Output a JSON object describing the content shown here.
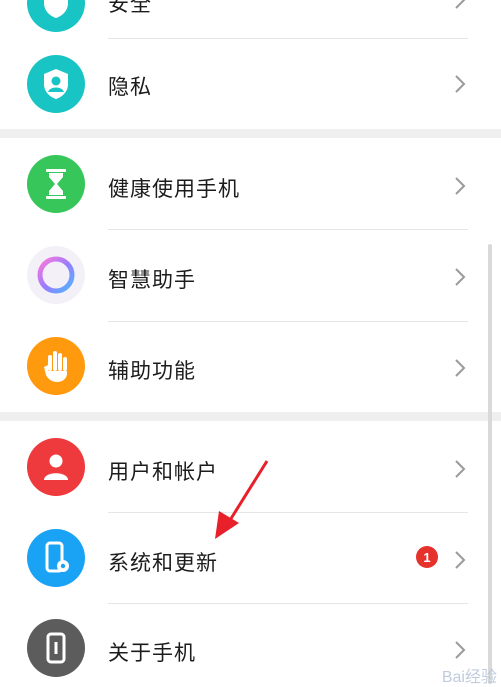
{
  "settings": {
    "items": [
      {
        "label": "安全",
        "icon": "shield-icon",
        "color": "#19c4c4"
      },
      {
        "label": "隐私",
        "icon": "privacy-shield-icon",
        "color": "#19c4c4"
      },
      {
        "label": "健康使用手机",
        "icon": "hourglass-icon",
        "color": "#36c65a"
      },
      {
        "label": "智慧助手",
        "icon": "assistant-ring-icon",
        "color": "#b07cf0"
      },
      {
        "label": "辅助功能",
        "icon": "hand-icon",
        "color": "#ff9a0f"
      },
      {
        "label": "用户和帐户",
        "icon": "user-icon",
        "color": "#ee3a3d"
      },
      {
        "label": "系统和更新",
        "icon": "phone-gear-icon",
        "color": "#1aa3f5",
        "badge": "1"
      },
      {
        "label": "关于手机",
        "icon": "phone-info-icon",
        "color": "#5c5c5c"
      }
    ]
  },
  "watermark": "Bai经验"
}
